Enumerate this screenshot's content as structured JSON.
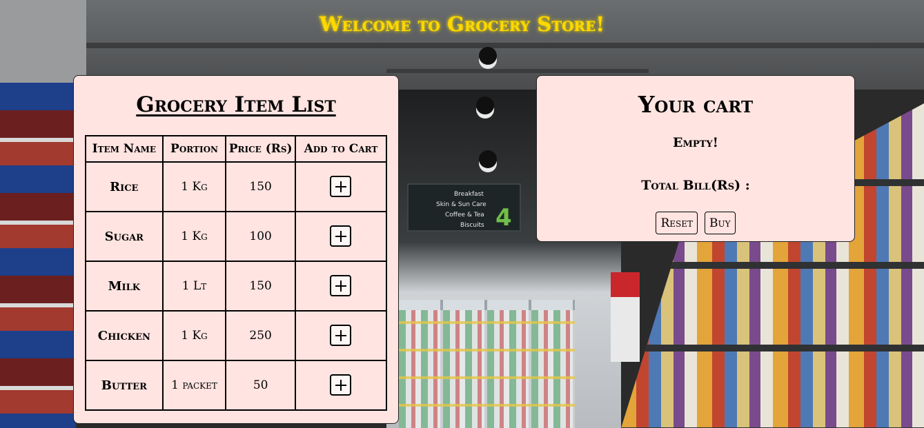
{
  "header": {
    "title": "Welcome to Grocery Store!"
  },
  "item_list": {
    "heading": "Grocery Item List",
    "columns": [
      "Item Name",
      "Portion",
      "Price (Rs)",
      "Add to Cart"
    ],
    "rows": [
      {
        "name": "Rice",
        "portion": "1 Kg",
        "price": "150"
      },
      {
        "name": "Sugar",
        "portion": "1 Kg",
        "price": "100"
      },
      {
        "name": "Milk",
        "portion": "1 Lt",
        "price": "150"
      },
      {
        "name": "Chicken",
        "portion": "1 Kg",
        "price": "250"
      },
      {
        "name": "Butter",
        "portion": "1 packet",
        "price": "50"
      }
    ]
  },
  "cart": {
    "heading": "Your cart",
    "status": "Empty!",
    "total_label": "Total Bill(Rs) :",
    "reset_label": "Reset",
    "buy_label": "Buy"
  },
  "background_sign": {
    "lines": [
      "Breakfast",
      "Skin & Sun Care",
      "Coffee & Tea",
      "Biscuits"
    ],
    "aisle_number": "4"
  },
  "colors": {
    "title": "#ffd800",
    "panel": "#ffe4e1"
  },
  "icons": {
    "add_button": "plus-icon"
  }
}
